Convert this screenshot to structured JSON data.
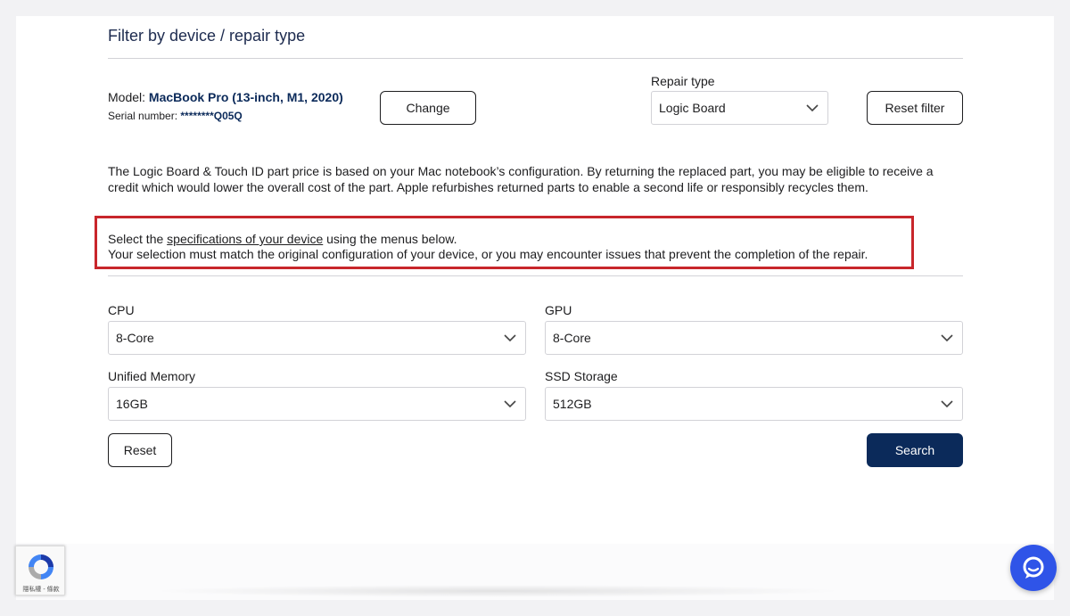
{
  "header": {
    "title": "Filter by device / repair type"
  },
  "device": {
    "model_label": "Model:",
    "model_value": "MacBook Pro (13-inch, M1, 2020)",
    "serial_label": "Serial number:",
    "serial_value": "********Q05Q",
    "change_label": "Change"
  },
  "repair_type": {
    "label": "Repair type",
    "selected": "Logic Board",
    "reset_filter_label": "Reset filter"
  },
  "info": {
    "text": "The Logic Board & Touch ID part price is based on your Mac notebook’s configuration. By returning the replaced part, you may be eligible to receive a credit which would lower the overall cost of the part. Apple refurbishes returned parts to enable a second life or responsibly recycles them."
  },
  "notice": {
    "line1_prefix": "Select the ",
    "line1_link": "specifications of your device",
    "line1_suffix": " using the menus below.",
    "line2": "Your selection must match the original configuration of your device, or you may encounter issues that prevent the completion of the repair."
  },
  "specs": {
    "cpu": {
      "label": "CPU",
      "selected": "8-Core"
    },
    "gpu": {
      "label": "GPU",
      "selected": "8-Core"
    },
    "memory": {
      "label": "Unified Memory",
      "selected": "16GB"
    },
    "storage": {
      "label": "SSD Storage",
      "selected": "512GB"
    }
  },
  "actions": {
    "reset_label": "Reset",
    "search_label": "Search"
  },
  "recaptcha": {
    "text": "隱私權 - 條款",
    "icon": "recaptcha-icon"
  },
  "chat": {
    "icon": "chat-icon"
  },
  "colors": {
    "primary": "#0b2a5a",
    "notice_border": "#c8262b",
    "chat": "#2f54e8"
  }
}
